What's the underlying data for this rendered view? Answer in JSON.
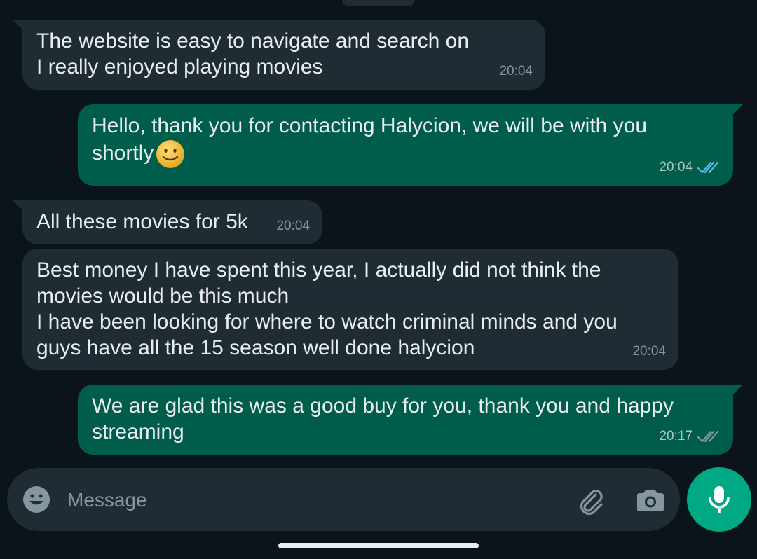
{
  "messages": [
    {
      "direction": "incoming",
      "text": "The website is easy to navigate and search on\nI really enjoyed playing movies",
      "time": "20:04"
    },
    {
      "direction": "outgoing",
      "text": "Hello, thank you for contacting Halycion, we will be with you\nshortly",
      "time": "20:04",
      "emoji": "slightly-smiling-face",
      "status": "read"
    },
    {
      "direction": "incoming",
      "text": "All these movies for 5k",
      "time": "20:04"
    },
    {
      "direction": "incoming",
      "text": "Best money I have spent this year, I actually did not think the\nmovies would be this much\nI have been looking for where to watch criminal minds and you\nguys have all the 15 season well done halycion",
      "time": "20:04"
    },
    {
      "direction": "outgoing",
      "text": "We are glad this was a good buy for you, thank you and happy\nstreaming",
      "time": "20:17",
      "status": "delivered"
    }
  ],
  "composer": {
    "placeholder": "Message",
    "icons": {
      "emoji": "emoji-icon",
      "attach": "paperclip-icon",
      "camera": "camera-icon",
      "mic": "microphone-icon"
    }
  },
  "colors": {
    "background": "#0b141a",
    "incoming_bubble": "#1f2c34",
    "outgoing_bubble": "#005c4b",
    "accent": "#00a884",
    "read_ticks": "#53bdeb",
    "delivered_ticks": "#8696a0"
  }
}
